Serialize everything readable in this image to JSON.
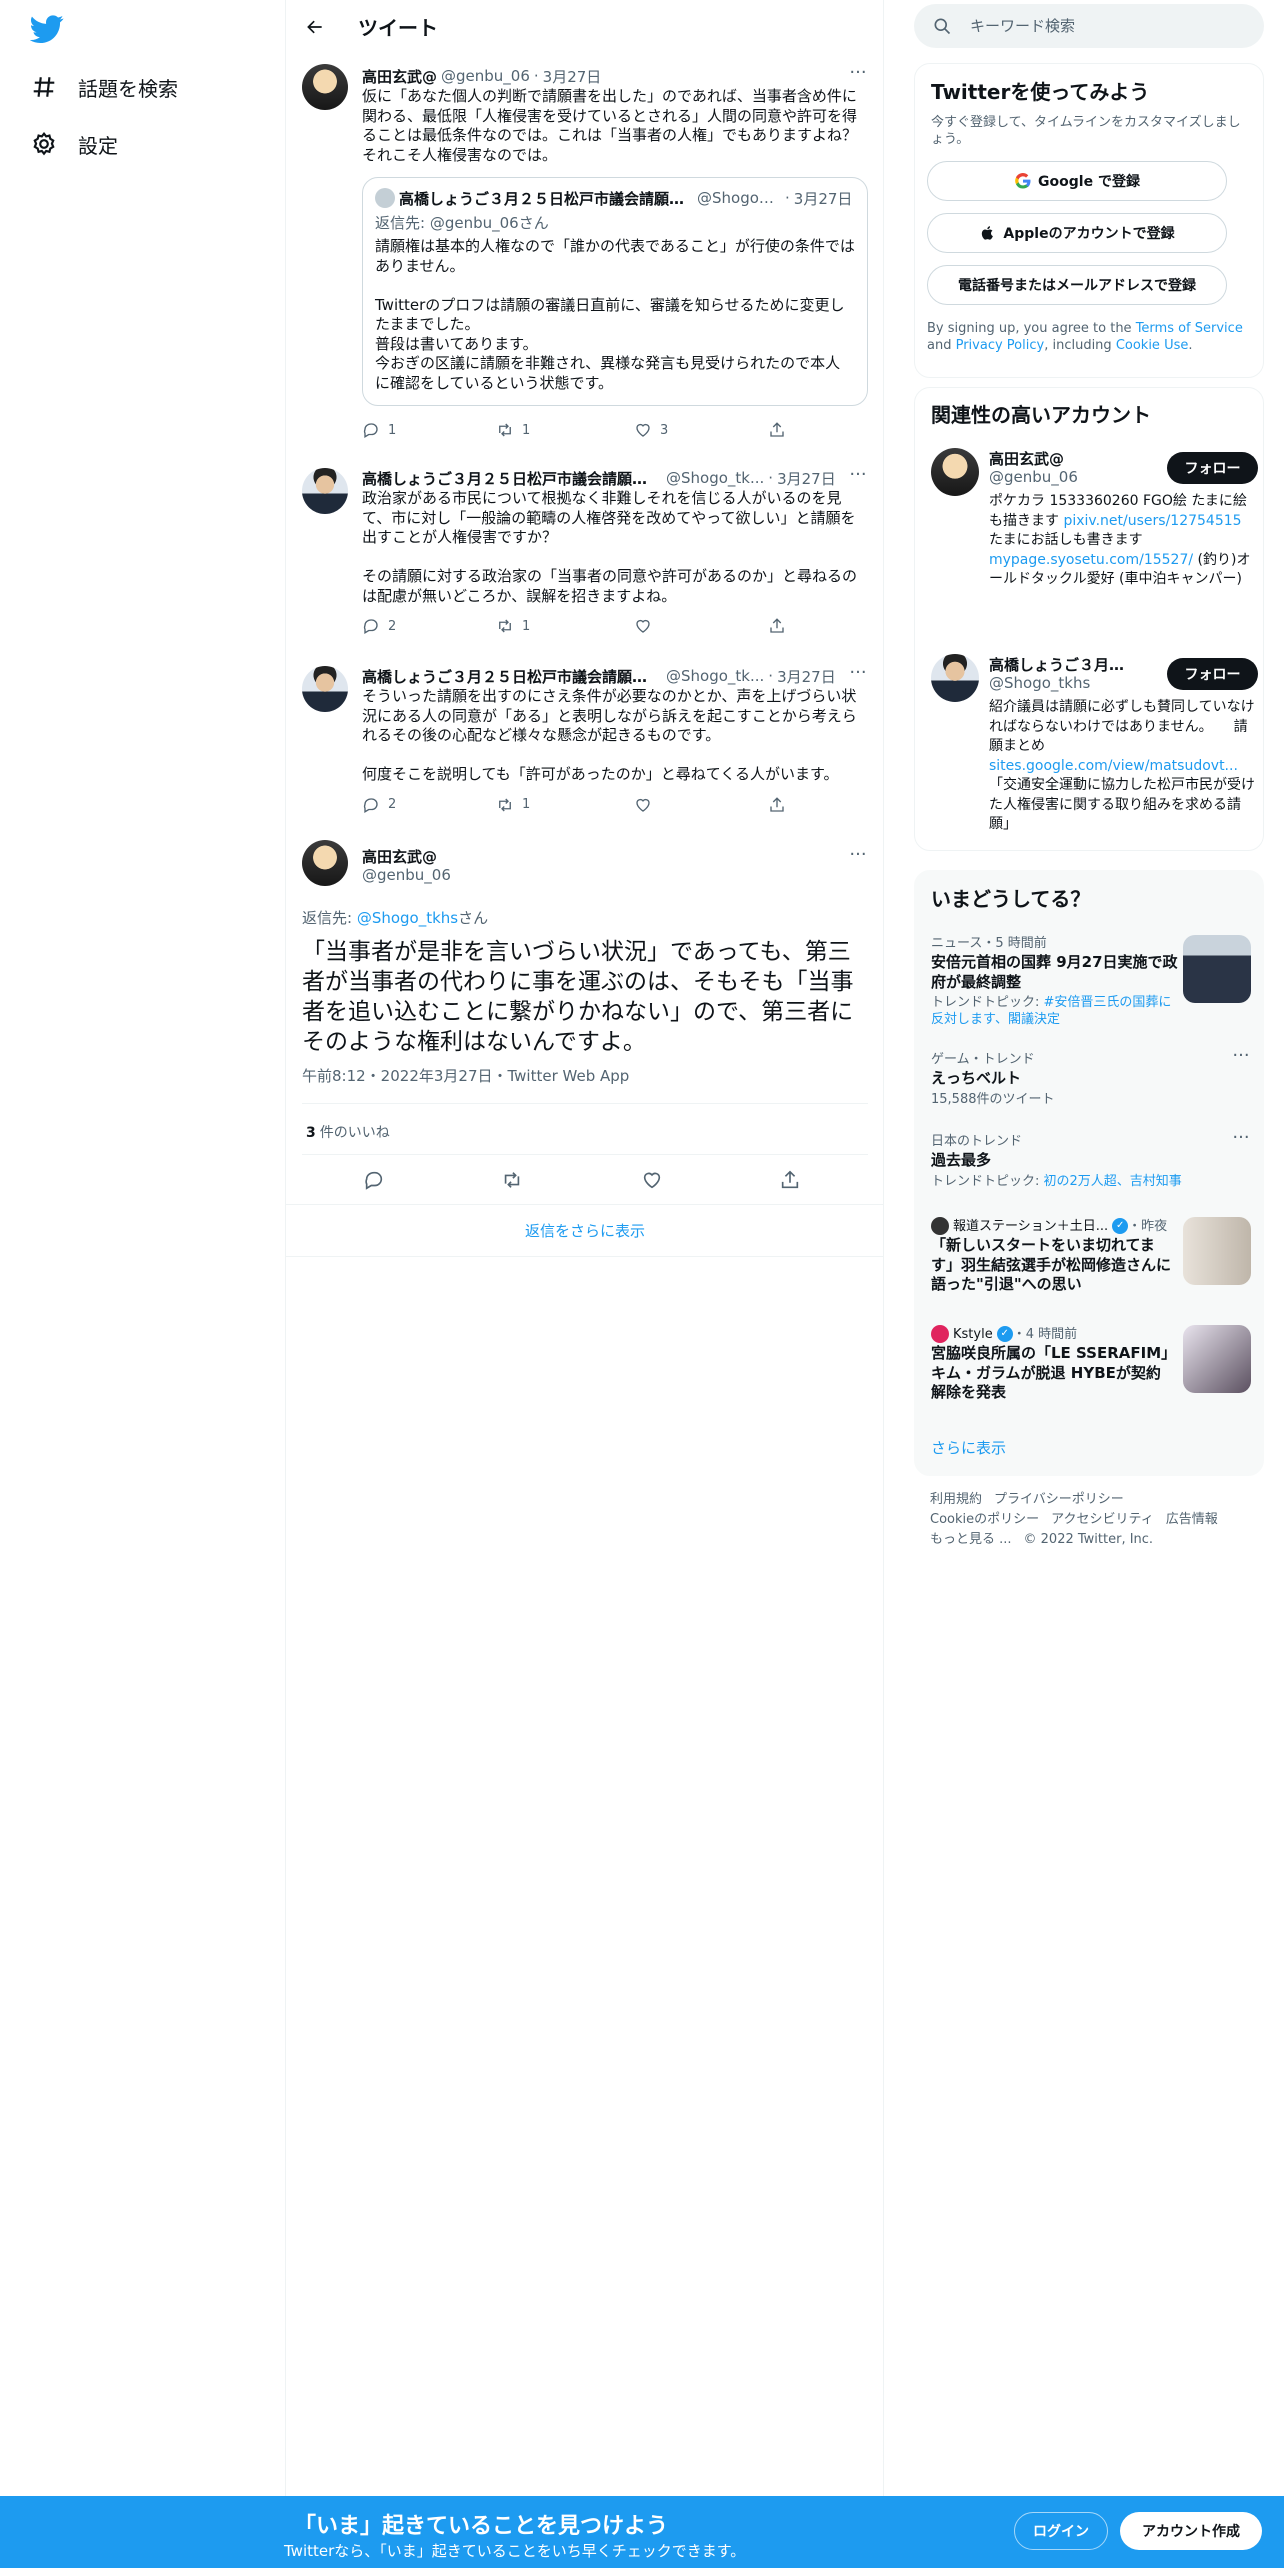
{
  "theme": {
    "accent": "#1d9bf0",
    "text": "#0f1419",
    "muted": "#536471"
  },
  "nav": {
    "logo_icon": "twitter-bird-icon",
    "items": [
      {
        "label": "話題を検索",
        "icon": "hashtag-icon"
      },
      {
        "label": "設定",
        "icon": "gear-icon"
      }
    ]
  },
  "header": {
    "title": "ツイート",
    "back_icon": "back-arrow-icon"
  },
  "thread": [
    {
      "name": "高田玄武@",
      "handle": "@genbu_06",
      "time": "3月27日",
      "text": "仮に「あなた個人の判断で請願書を出した」のであれば、当事者含め件に関わる、最低限「人権侵害を受けているとされる」人間の同意や許可を得ることは最低条件なのでは。これは「当事者の人権」でもありますよね？それこそ人権侵害なのでは。",
      "quote": {
        "name": "高橋しょうご３月２５日松戸市議会請願...",
        "handle": "@Shogo_t...",
        "time": "3月27日",
        "reply_to": "返信先: @genbu_06さん",
        "text": "請願権は基本的人権なので「誰かの代表であること」が行使の条件ではありません。\n\nTwitterのプロフは請願の審議日直前に、審議を知らせるために変更したままでした。\n普段は書いてあります。\n今おぎの区議に請願を非難され、異様な発言も見受けられたので本人に確認をしているという状態です。"
      },
      "counts": {
        "reply": "1",
        "retweet": "1",
        "like": "3"
      }
    },
    {
      "name": "高橋しょうご３月２５日松戸市議会請願審...",
      "handle": "@Shogo_tk...",
      "time": "3月27日",
      "text": "政治家がある市民について根拠なく非難しそれを信じる人がいるのを見て、市に対し「一般論の範疇の人権啓発を改めてやって欲しい」と請願を出すことが人権侵害ですか？\n\nその請願に対する政治家の「当事者の同意や許可があるのか」と尋ねるのは配慮が無いどころか、誤解を招きますよね。",
      "counts": {
        "reply": "2",
        "retweet": "1",
        "like": ""
      }
    },
    {
      "name": "高橋しょうご３月２５日松戸市議会請願審...",
      "handle": "@Shogo_tk...",
      "time": "3月27日",
      "text": "そういった請願を出すのにさえ条件が必要なのかとか、声を上げづらい状況にある人の同意が「ある」と表明しながら訴えを起こすことから考えられるその後の心配など様々な懸念が起きるものです。\n\n何度そこを説明しても「許可があったのか」と尋ねてくる人がいます。",
      "counts": {
        "reply": "2",
        "retweet": "1",
        "like": ""
      }
    }
  ],
  "focus": {
    "name": "高田玄武@",
    "handle": "@genbu_06",
    "reply_prefix": "返信先: ",
    "reply_to": "@Shogo_tkhs",
    "reply_suffix": "さん",
    "text": "「当事者が是非を言いづらい状況」であっても、第三者が当事者の代わりに事を運ぶのは、そもそも「当事者を追い込むことに繋がりかねない」ので、第三者にそのような権利はないんですよ。",
    "meta": "午前8:12・2022年3月27日・Twitter Web App",
    "likes_count": "3",
    "likes_label": "件のいいね",
    "show_more": "返信をさらに表示"
  },
  "search": {
    "placeholder": "キーワード検索"
  },
  "signup": {
    "title": "Twitterを使ってみよう",
    "subtitle": "今すぐ登録して、タイムラインをカスタマイズしましょう。",
    "google": "Google で登録",
    "apple": "Appleのアカウントで登録",
    "phone": "電話番号またはメールアドレスで登録",
    "terms_1": "By signing up, you agree to the ",
    "terms_link1": "Terms of Service",
    "terms_2": " and ",
    "terms_link2": "Privacy Policy",
    "terms_3": ", including ",
    "terms_link3": "Cookie Use",
    "terms_4": "."
  },
  "who": {
    "title": "関連性の高いアカウント",
    "accounts": [
      {
        "name": "高田玄武@",
        "handle": "@genbu_06",
        "follow": "フォロー",
        "bio_1": "ポケカラ 1533360260 FGO絵 たまに絵も描きます ",
        "bio_link1": "pixiv.net/users/12754515",
        "bio_2": " たまにお話しも書きます ",
        "bio_link2": "mypage.syosetu.com/15527/",
        "bio_3": " (釣り)オールドタックル愛好 (車中泊キャンパー)"
      },
      {
        "name": "高橋しょうご３月２...",
        "handle": "@Shogo_tkhs",
        "follow": "フォロー",
        "bio_1": "紹介議員は請願に必ずしも賛同していなければならないわけではありません。　　請願まとめ",
        "bio_link1": "sites.google.com/view/matsudovt...",
        "bio_2": "「交通安全運動に協力した松戸市民が受けた人権侵害に関する取り組みを求める請願」"
      }
    ]
  },
  "trends": {
    "title": "いまどうしてる？",
    "items": [
      {
        "cat": "ニュース・5 時間前",
        "title": "安倍元首相の国葬 9月27日実施で政府が最終調整",
        "sub_prefix": "トレンドトピック: ",
        "sub_link": "#安倍晋三氏の国葬に反対します、閣議決定",
        "image": "news-photo"
      },
      {
        "cat": "ゲーム・トレンド",
        "title": "えっちベルト",
        "sub": "15,588件のツイート"
      },
      {
        "cat": "日本のトレンド",
        "title": "過去最多",
        "sub_prefix": "トレンドトピック: ",
        "sub_link": "初の2万人超、吉村知事"
      },
      {
        "source": "報道ステーション＋土日...",
        "time": "・昨夜",
        "title": "「新しいスタートをいま切れてます」羽生結弦選手が松岡修造さんに語った\"引退\"への思い",
        "image": "news-photo"
      },
      {
        "source": "Kstyle",
        "time": "・4 時間前",
        "title": "宮脇咲良所属の「LE SSERAFIM」キム・ガラムが脱退 HYBEが契約解除を発表",
        "image": "news-photo"
      }
    ],
    "more": "さらに表示"
  },
  "footer": {
    "links": [
      "利用規約",
      "プライバシーポリシー",
      "Cookieのポリシー",
      "アクセシビリティ",
      "広告情報",
      "もっと見る ..."
    ],
    "copyright": "© 2022 Twitter, Inc."
  },
  "bottom": {
    "title": "「いま」起きていることを見つけよう",
    "subtitle": "Twitterなら、「いま」起きていることをいち早くチェックできます。",
    "login": "ログイン",
    "signup": "アカウント作成"
  }
}
